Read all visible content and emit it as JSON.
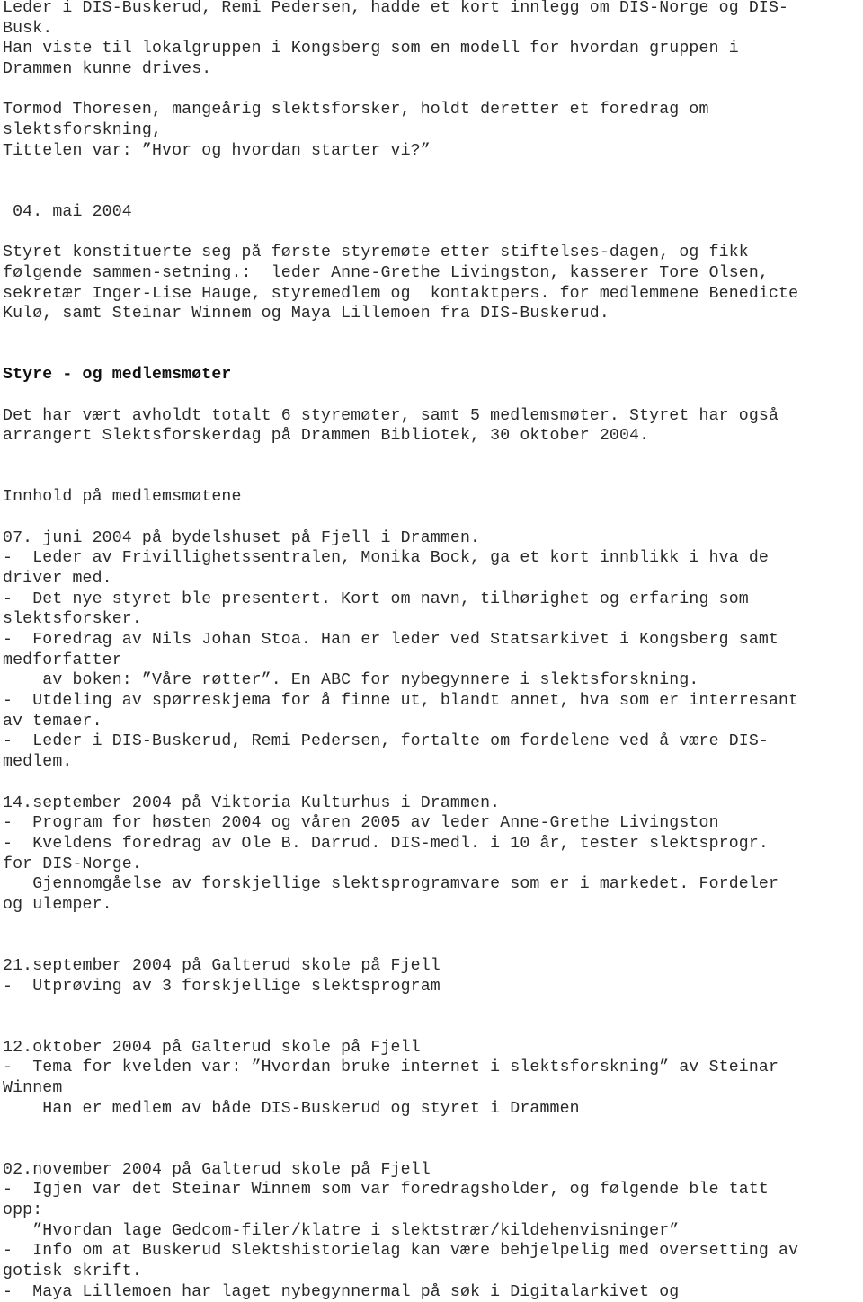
{
  "document": {
    "lines": [
      {
        "text": "Leder i DIS-Buskerud, Remi Pedersen, hadde et kort innlegg om DIS-Norge og DIS-",
        "row": 0
      },
      {
        "text": "Busk.",
        "row": 1
      },
      {
        "text": "Han viste til lokalgruppen i Kongsberg som en modell for hvordan gruppen i",
        "row": 2
      },
      {
        "text": "Drammen kunne drives.",
        "row": 3
      },
      {
        "text": "Tormod Thoresen, mangeårig slektsforsker, holdt deretter et foredrag om",
        "row": 5
      },
      {
        "text": "slektsforskning,",
        "row": 6
      },
      {
        "text": "Tittelen var: ”Hvor og hvordan starter vi?”",
        "row": 7
      },
      {
        "text": " 04. mai 2004",
        "row": 10
      },
      {
        "text": "Styret konstituerte seg på første styremøte etter stiftelses-dagen, og fikk",
        "row": 12
      },
      {
        "text": "følgende sammen-setning.:  leder Anne-Grethe Livingston, kasserer Tore Olsen,",
        "row": 13
      },
      {
        "text": "sekretær Inger-Lise Hauge, styremedlem og  kontaktpers. for medlemmene Benedicte",
        "row": 14
      },
      {
        "text": "Kulø, samt Steinar Winnem og Maya Lillemoen fra DIS-Buskerud.",
        "row": 15
      },
      {
        "text": "Styre - og medlemsmøter",
        "row": 18,
        "bold": true
      },
      {
        "text": "Det har vært avholdt totalt 6 styremøter, samt 5 medlemsmøter. Styret har også",
        "row": 20
      },
      {
        "text": "arrangert Slektsforskerdag på Drammen Bibliotek, 30 oktober 2004.",
        "row": 21
      },
      {
        "text": "Innhold på medlemsmøtene",
        "row": 24
      },
      {
        "text": "07. juni 2004 på bydelshuset på Fjell i Drammen.",
        "row": 26
      },
      {
        "text": "-  Leder av Frivillighetssentralen, Monika Bock, ga et kort innblikk i hva de",
        "row": 27
      },
      {
        "text": "driver med.",
        "row": 28
      },
      {
        "text": "-  Det nye styret ble presentert. Kort om navn, tilhørighet og erfaring som",
        "row": 29
      },
      {
        "text": "slektsforsker.",
        "row": 30
      },
      {
        "text": "-  Foredrag av Nils Johan Stoa. Han er leder ved Statsarkivet i Kongsberg samt",
        "row": 31
      },
      {
        "text": "medforfatter",
        "row": 32
      },
      {
        "text": "    av boken: ”Våre røtter”. En ABC for nybegynnere i slektsforskning.",
        "row": 33
      },
      {
        "text": "-  Utdeling av spørreskjema for å finne ut, blandt annet, hva som er interresant",
        "row": 34
      },
      {
        "text": "av temaer.",
        "row": 35
      },
      {
        "text": "-  Leder i DIS-Buskerud, Remi Pedersen, fortalte om fordelene ved å være DIS-",
        "row": 36
      },
      {
        "text": "medlem.",
        "row": 37
      },
      {
        "text": "14.september 2004 på Viktoria Kulturhus i Drammen.",
        "row": 39
      },
      {
        "text": "-  Program for høsten 2004 og våren 2005 av leder Anne-Grethe Livingston",
        "row": 40
      },
      {
        "text": "-  Kveldens foredrag av Ole B. Darrud. DIS-medl. i 10 år, tester slektsprogr.",
        "row": 41
      },
      {
        "text": "for DIS-Norge.",
        "row": 42
      },
      {
        "text": "   Gjennomgåelse av forskjellige slektsprogramvare som er i markedet. Fordeler",
        "row": 43
      },
      {
        "text": "og ulemper.",
        "row": 44
      },
      {
        "text": "21.september 2004 på Galterud skole på Fjell",
        "row": 47
      },
      {
        "text": "-  Utprøving av 3 forskjellige slektsprogram",
        "row": 48
      },
      {
        "text": "12.oktober 2004 på Galterud skole på Fjell",
        "row": 51
      },
      {
        "text": "-  Tema for kvelden var: ”Hvordan bruke internet i slektsforskning” av Steinar",
        "row": 52
      },
      {
        "text": "Winnem",
        "row": 53
      },
      {
        "text": "    Han er medlem av både DIS-Buskerud og styret i Drammen",
        "row": 54
      },
      {
        "text": "02.november 2004 på Galterud skole på Fjell",
        "row": 57
      },
      {
        "text": "-  Igjen var det Steinar Winnem som var foredragsholder, og følgende ble tatt",
        "row": 58
      },
      {
        "text": "opp:",
        "row": 59
      },
      {
        "text": "   ”Hvordan lage Gedcom-filer/klatre i slektstrær/kildehenvisninger”",
        "row": 60
      },
      {
        "text": "-  Info om at Buskerud Slektshistorielag kan være behjelpelig med oversetting av",
        "row": 61
      },
      {
        "text": "gotisk skrift.",
        "row": 62
      },
      {
        "text": "-  Maya Lillemoen har laget nybegynnermal på søk i Digitalarkivet og",
        "row": 63
      }
    ]
  }
}
